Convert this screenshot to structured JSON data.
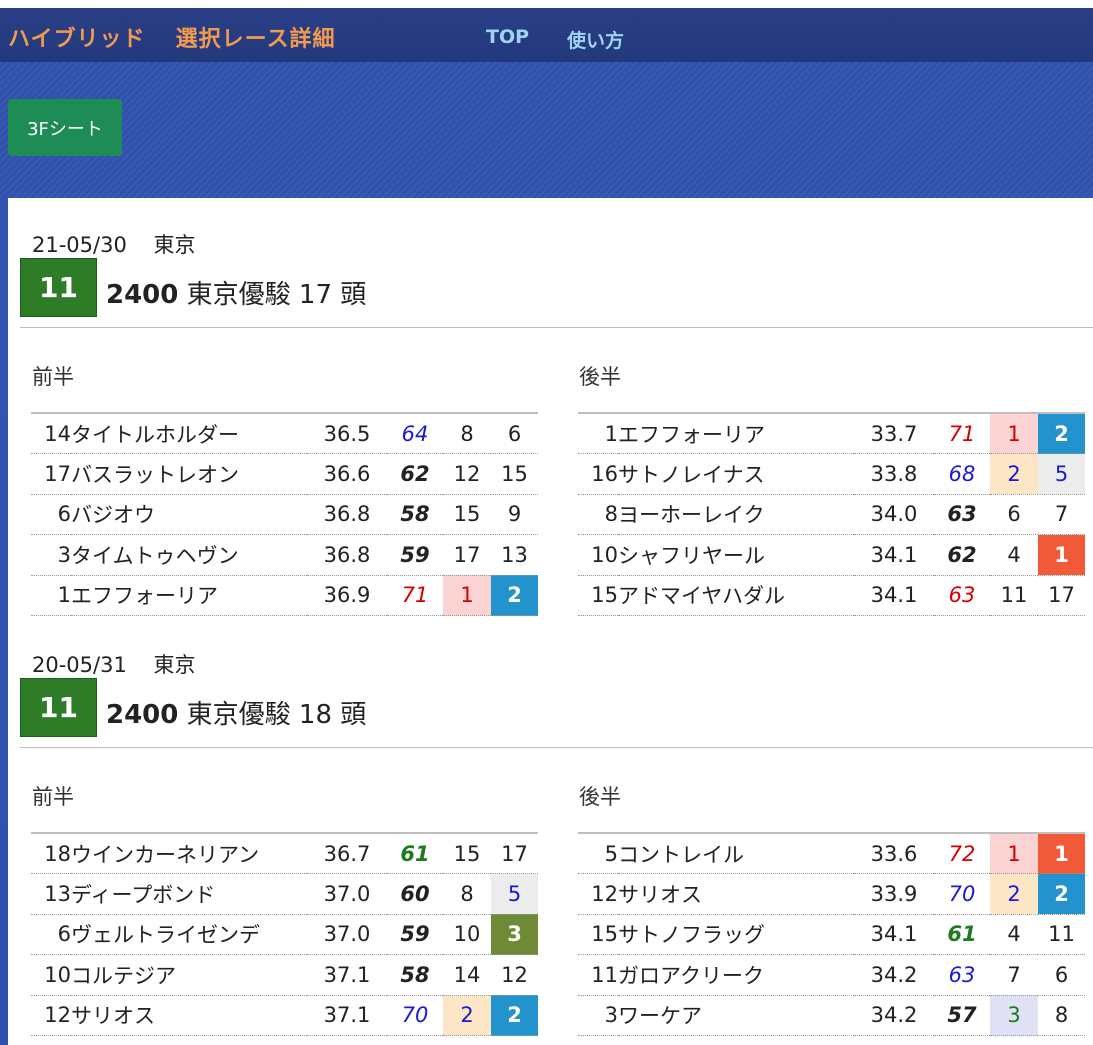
{
  "header": {
    "brand_part1": "ハイブリッド",
    "brand_part2": "選択レース詳細",
    "nav_top": "TOP",
    "nav_usage": "使い方",
    "sheet_button": "3Fシート"
  },
  "races": [
    {
      "date": "21-05/30",
      "venue": "東京",
      "race_no": "11",
      "distance": "2400",
      "name": "東京優駿",
      "heads": "17",
      "heads_unit": "頭",
      "first_label": "前半",
      "second_label": "後半",
      "first_half": [
        {
          "no": "14",
          "name": "タイトルホルダー",
          "time": "36.5",
          "score": "64",
          "r1": "8",
          "r2": "6"
        },
        {
          "no": "17",
          "name": "バスラットレオン",
          "time": "36.6",
          "score": "62",
          "r1": "12",
          "r2": "15"
        },
        {
          "no": "6",
          "name": "バジオウ",
          "time": "36.8",
          "score": "58",
          "r1": "15",
          "r2": "9"
        },
        {
          "no": "3",
          "name": "タイムトゥヘヴン",
          "time": "36.8",
          "score": "59",
          "r1": "17",
          "r2": "13"
        },
        {
          "no": "1",
          "name": "エフフォーリア",
          "time": "36.9",
          "score": "71",
          "r1": "1",
          "r2": "2"
        }
      ],
      "second_half": [
        {
          "no": "1",
          "name": "エフフォーリア",
          "time": "33.7",
          "score": "71",
          "r1": "1",
          "r2": "2"
        },
        {
          "no": "16",
          "name": "サトノレイナス",
          "time": "33.8",
          "score": "68",
          "r1": "2",
          "r2": "5"
        },
        {
          "no": "8",
          "name": "ヨーホーレイク",
          "time": "34.0",
          "score": "63",
          "r1": "6",
          "r2": "7"
        },
        {
          "no": "10",
          "name": "シャフリヤール",
          "time": "34.1",
          "score": "62",
          "r1": "4",
          "r2": "1"
        },
        {
          "no": "15",
          "name": "アドマイヤハダル",
          "time": "34.1",
          "score": "63",
          "r1": "11",
          "r2": "17"
        }
      ]
    },
    {
      "date": "20-05/31",
      "venue": "東京",
      "race_no": "11",
      "distance": "2400",
      "name": "東京優駿",
      "heads": "18",
      "heads_unit": "頭",
      "first_label": "前半",
      "second_label": "後半",
      "first_half": [
        {
          "no": "18",
          "name": "ウインカーネリアン",
          "time": "36.7",
          "score": "61",
          "r1": "15",
          "r2": "17"
        },
        {
          "no": "13",
          "name": "ディープボンド",
          "time": "37.0",
          "score": "60",
          "r1": "8",
          "r2": "5"
        },
        {
          "no": "6",
          "name": "ヴェルトライゼンデ",
          "time": "37.0",
          "score": "59",
          "r1": "10",
          "r2": "3"
        },
        {
          "no": "10",
          "name": "コルテジア",
          "time": "37.1",
          "score": "58",
          "r1": "14",
          "r2": "12"
        },
        {
          "no": "12",
          "name": "サリオス",
          "time": "37.1",
          "score": "70",
          "r1": "2",
          "r2": "2"
        }
      ],
      "second_half": [
        {
          "no": "5",
          "name": "コントレイル",
          "time": "33.6",
          "score": "72",
          "r1": "1",
          "r2": "1"
        },
        {
          "no": "12",
          "name": "サリオス",
          "time": "33.9",
          "score": "70",
          "r1": "2",
          "r2": "2"
        },
        {
          "no": "15",
          "name": "サトノフラッグ",
          "time": "34.1",
          "score": "61",
          "r1": "4",
          "r2": "11"
        },
        {
          "no": "11",
          "name": "ガロアクリーク",
          "time": "34.2",
          "score": "63",
          "r1": "7",
          "r2": "6"
        },
        {
          "no": "3",
          "name": "ワーケア",
          "time": "34.2",
          "score": "57",
          "r1": "3",
          "r2": "8"
        }
      ]
    }
  ],
  "colors": {
    "navbar": "#23397c",
    "brand": "#f29a4f",
    "nav_link": "#9fd3f2",
    "hero": "#3254b0",
    "sheet_button": "#1e8d55",
    "race_badge": "#2e7b28",
    "rank_blue": "#2293cc",
    "rank_orange": "#f15a38",
    "rank_olive": "#6e8a36",
    "rank_pink": "#fcd3d3",
    "rank_peach": "#fde6c6"
  }
}
